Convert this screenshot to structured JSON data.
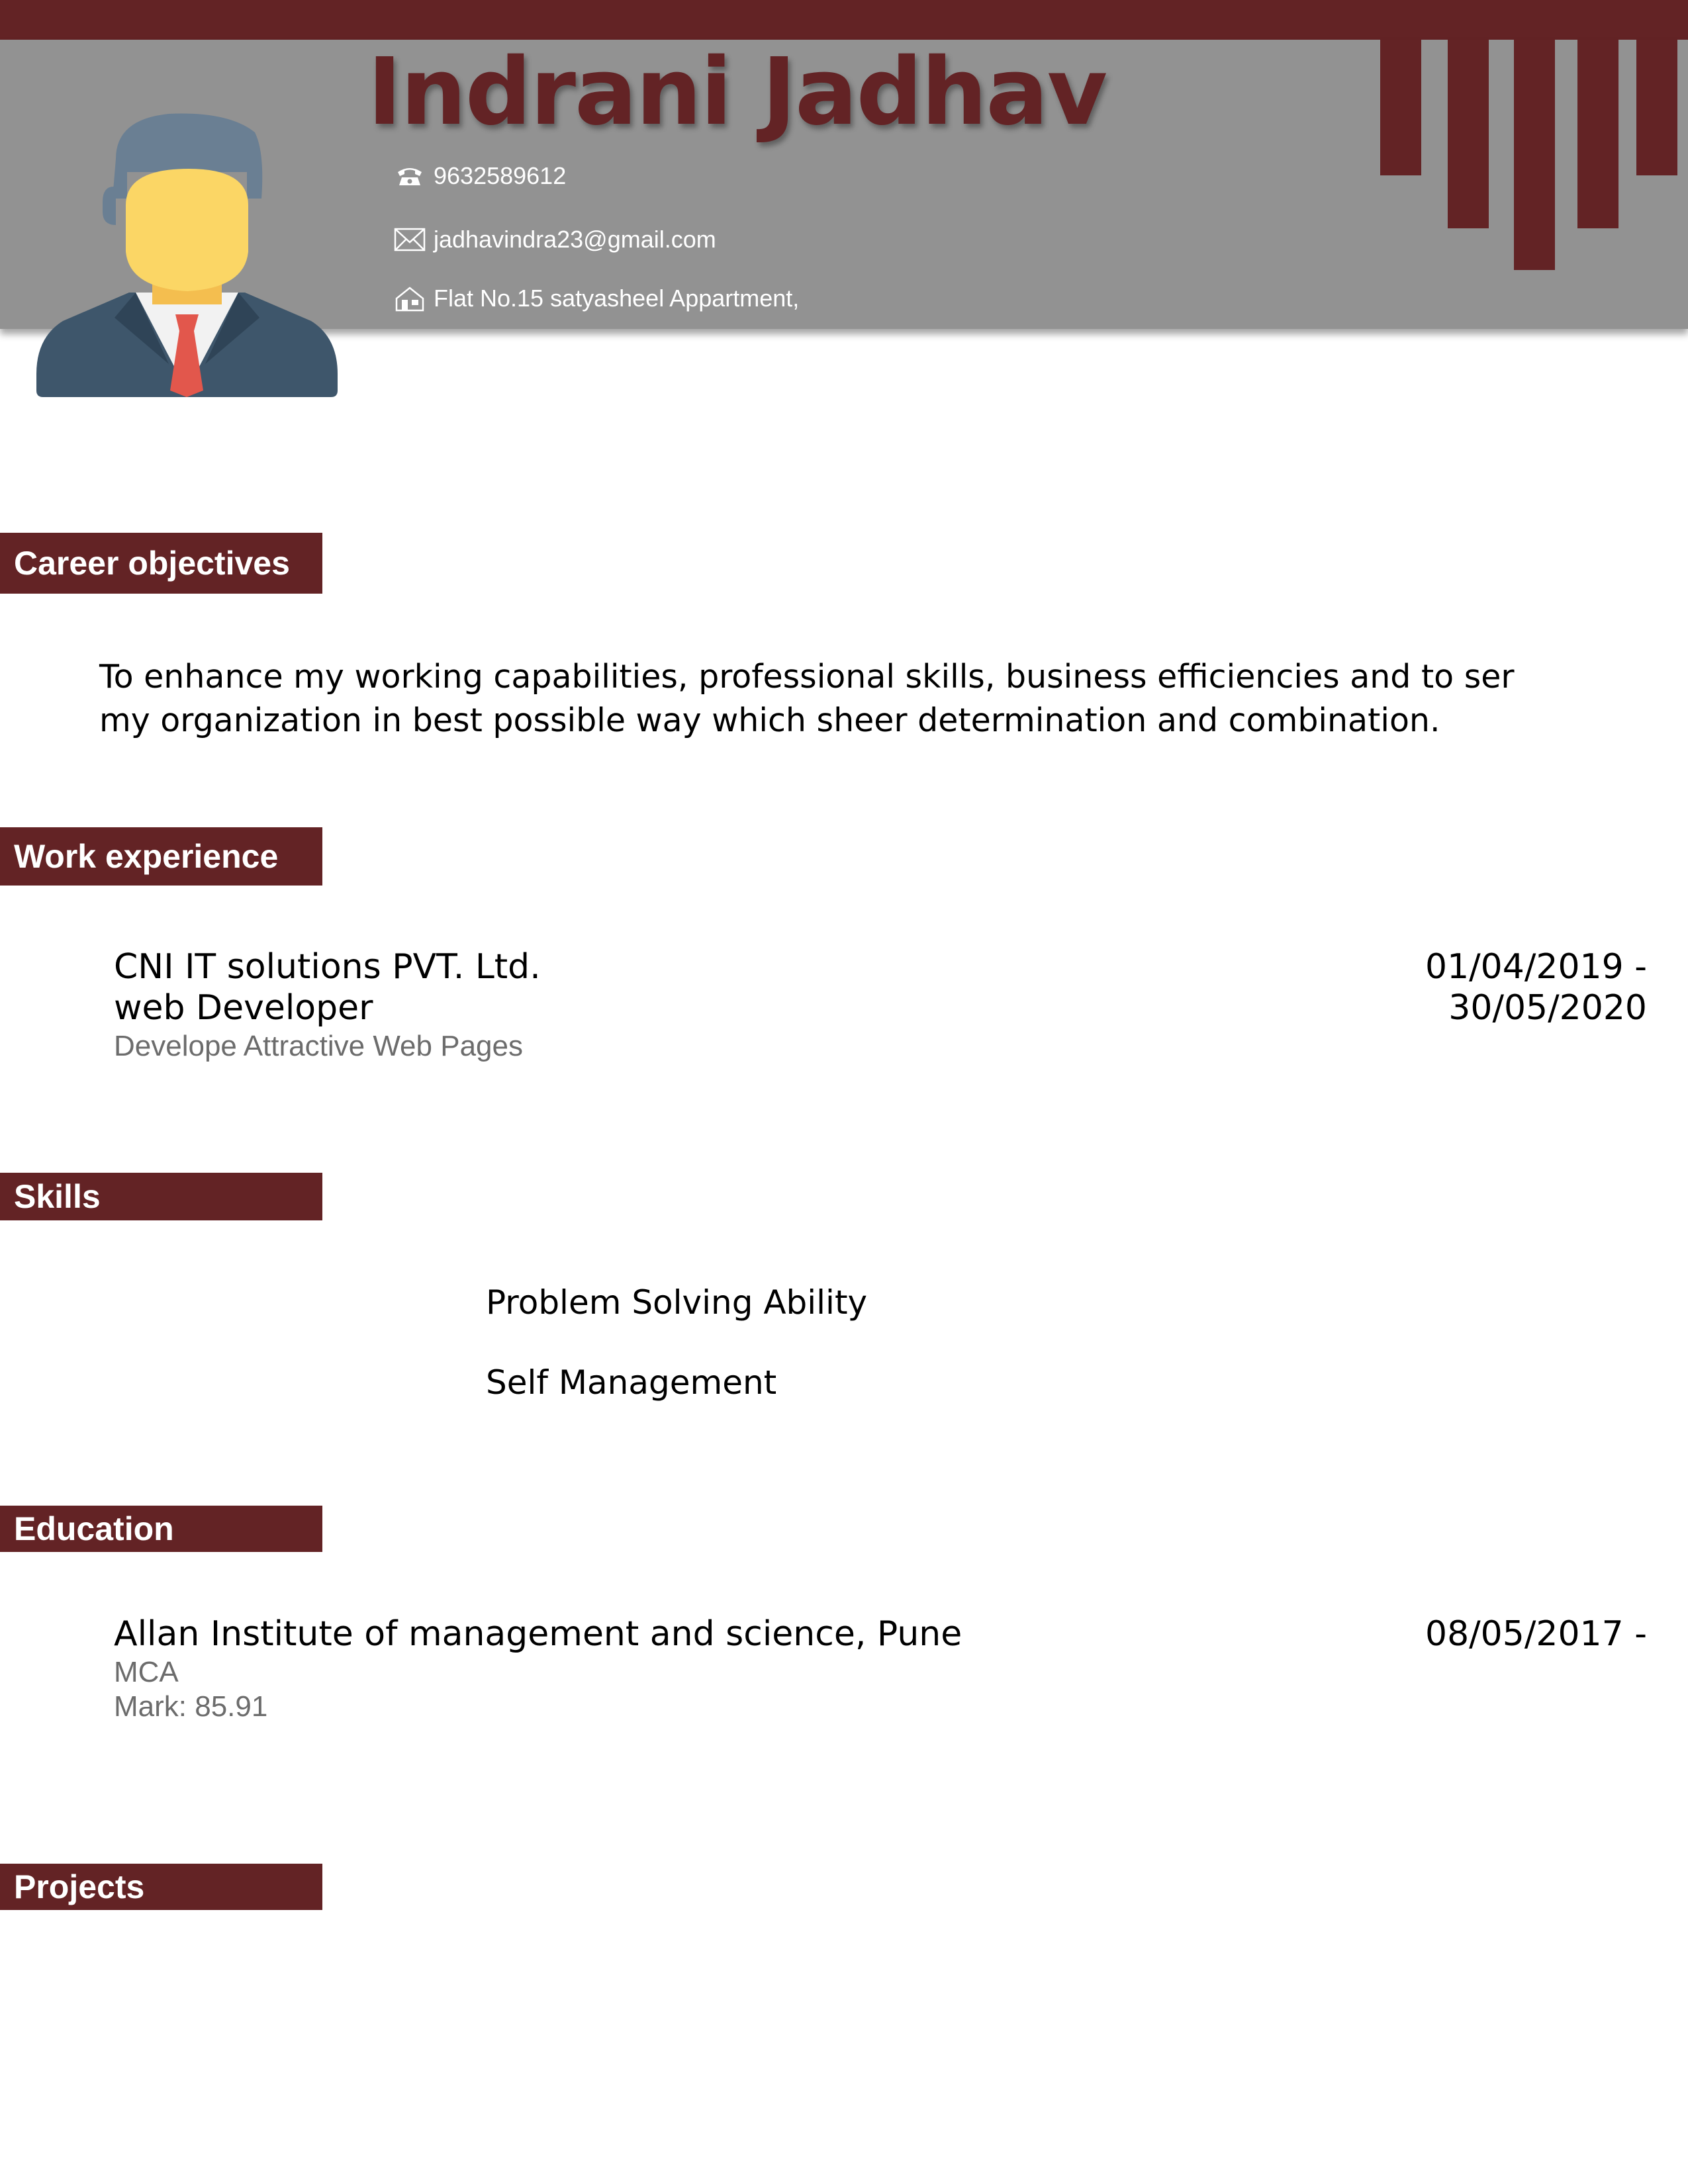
{
  "header": {
    "name": "Indrani Jadhav",
    "phone": "9632589612",
    "email": "jadhavindra23@gmail.com",
    "address": "Flat No.15 satyasheel Appartment,",
    "icons": [
      "phone-icon",
      "mail-icon",
      "home-icon"
    ]
  },
  "sections": {
    "career": {
      "title": "Career objectives",
      "lines": [
        "To enhance my working capabilities, professional skills, business efficiencies and to ser",
        "my organization in best possible way which sheer determination and combination."
      ]
    },
    "work": {
      "title": "Work experience",
      "company": "CNI IT solutions PVT. Ltd.",
      "role": "web Developer",
      "description": "Develope Attractive Web Pages",
      "date_start": "01/04/2019 -",
      "date_end": "30/05/2020"
    },
    "skills": {
      "title": "Skills",
      "items": [
        "Problem Solving Ability",
        "Self Management"
      ]
    },
    "education": {
      "title": "Education",
      "institute": "Allan Institute of management and science, Pune",
      "degree": "MCA",
      "mark": "Mark: 85.91",
      "date_start": "08/05/2017 -"
    },
    "projects": {
      "title": "Projects"
    }
  },
  "colors": {
    "accent": "#632325",
    "header_gray": "#929292",
    "muted_text": "#6c6c6c"
  }
}
